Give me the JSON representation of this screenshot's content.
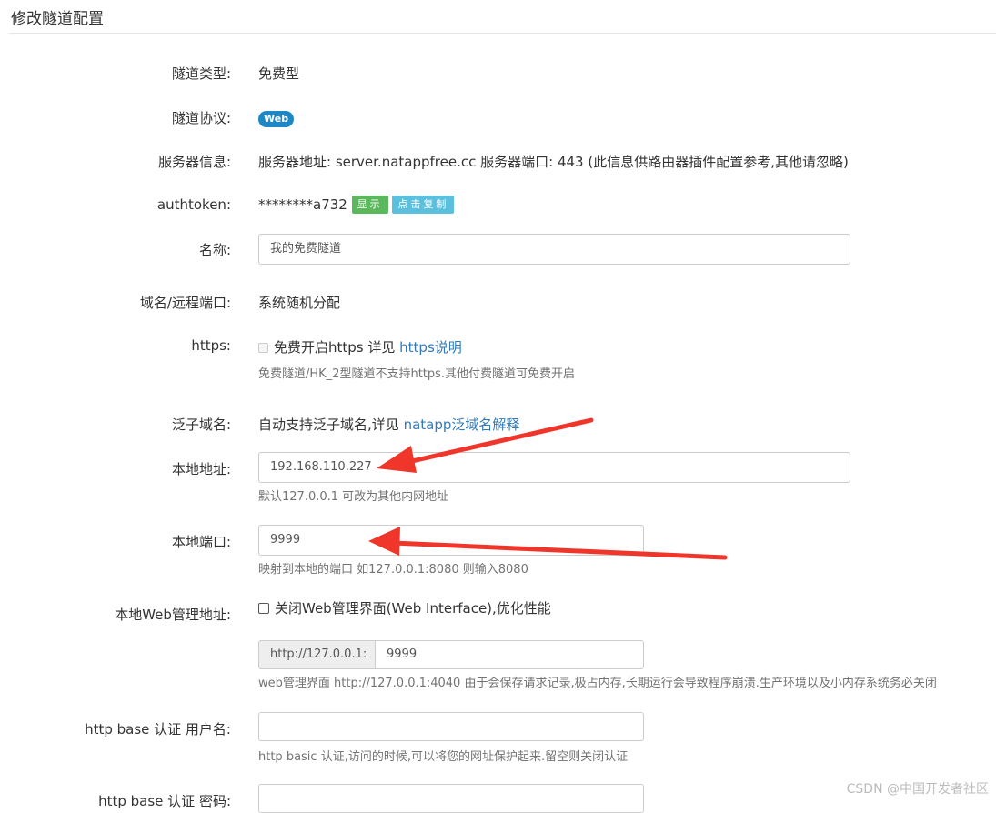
{
  "page": {
    "title": "修改隧道配置"
  },
  "rows": {
    "type": {
      "label": "隧道类型:",
      "value": "免费型"
    },
    "protocol": {
      "label": "隧道协议:",
      "badge": "Web"
    },
    "server": {
      "label": "服务器信息:",
      "value": "服务器地址: server.natappfree.cc 服务器端口: 443 (此信息供路由器插件配置参考,其他请忽略)"
    },
    "authtoken": {
      "label": "authtoken:",
      "value": "********a732",
      "show_button": "显示",
      "copy_button": "点击复制"
    },
    "name": {
      "label": "名称:",
      "value": "我的免费隧道"
    },
    "domain": {
      "label": "域名/远程端口:",
      "value": "系统随机分配"
    },
    "https": {
      "label": "https:",
      "checkbox_text": "免费开启https 详见",
      "link": "https说明",
      "hint": "免费隧道/HK_2型隧道不支持https.其他付费隧道可免费开启"
    },
    "wildcard": {
      "label": "泛子域名:",
      "text": "自动支持泛子域名,详见",
      "link": "natapp泛域名解释"
    },
    "local_addr": {
      "label": "本地地址:",
      "value": "192.168.110.227",
      "hint": "默认127.0.0.1 可改为其他内网地址"
    },
    "local_port": {
      "label": "本地端口:",
      "value": "9999",
      "hint": "映射到本地的端口 如127.0.0.1:8080 则输入8080"
    },
    "web_admin": {
      "label": "本地Web管理地址:",
      "checkbox_text": "关闭Web管理界面(Web Interface),优化性能",
      "prefix": "http://127.0.0.1:",
      "value": "9999",
      "hint": "web管理界面 http://127.0.0.1:4040 由于会保存请求记录,极占内存,长期运行会导致程序崩溃.生产环境以及小内存系统务必关闭"
    },
    "auth_user": {
      "label": "http base 认证 用户名:",
      "value": "",
      "hint": "http basic 认证,访问的时候,可以将您的网址保护起来.留空则关闭认证"
    },
    "auth_pass": {
      "label": "http base 认证 密码:",
      "value": ""
    }
  },
  "watermark": "CSDN @中国开发者社区",
  "colors": {
    "arrow": "#f0352b",
    "link": "#337ab7",
    "badge": "#1e88c7"
  }
}
